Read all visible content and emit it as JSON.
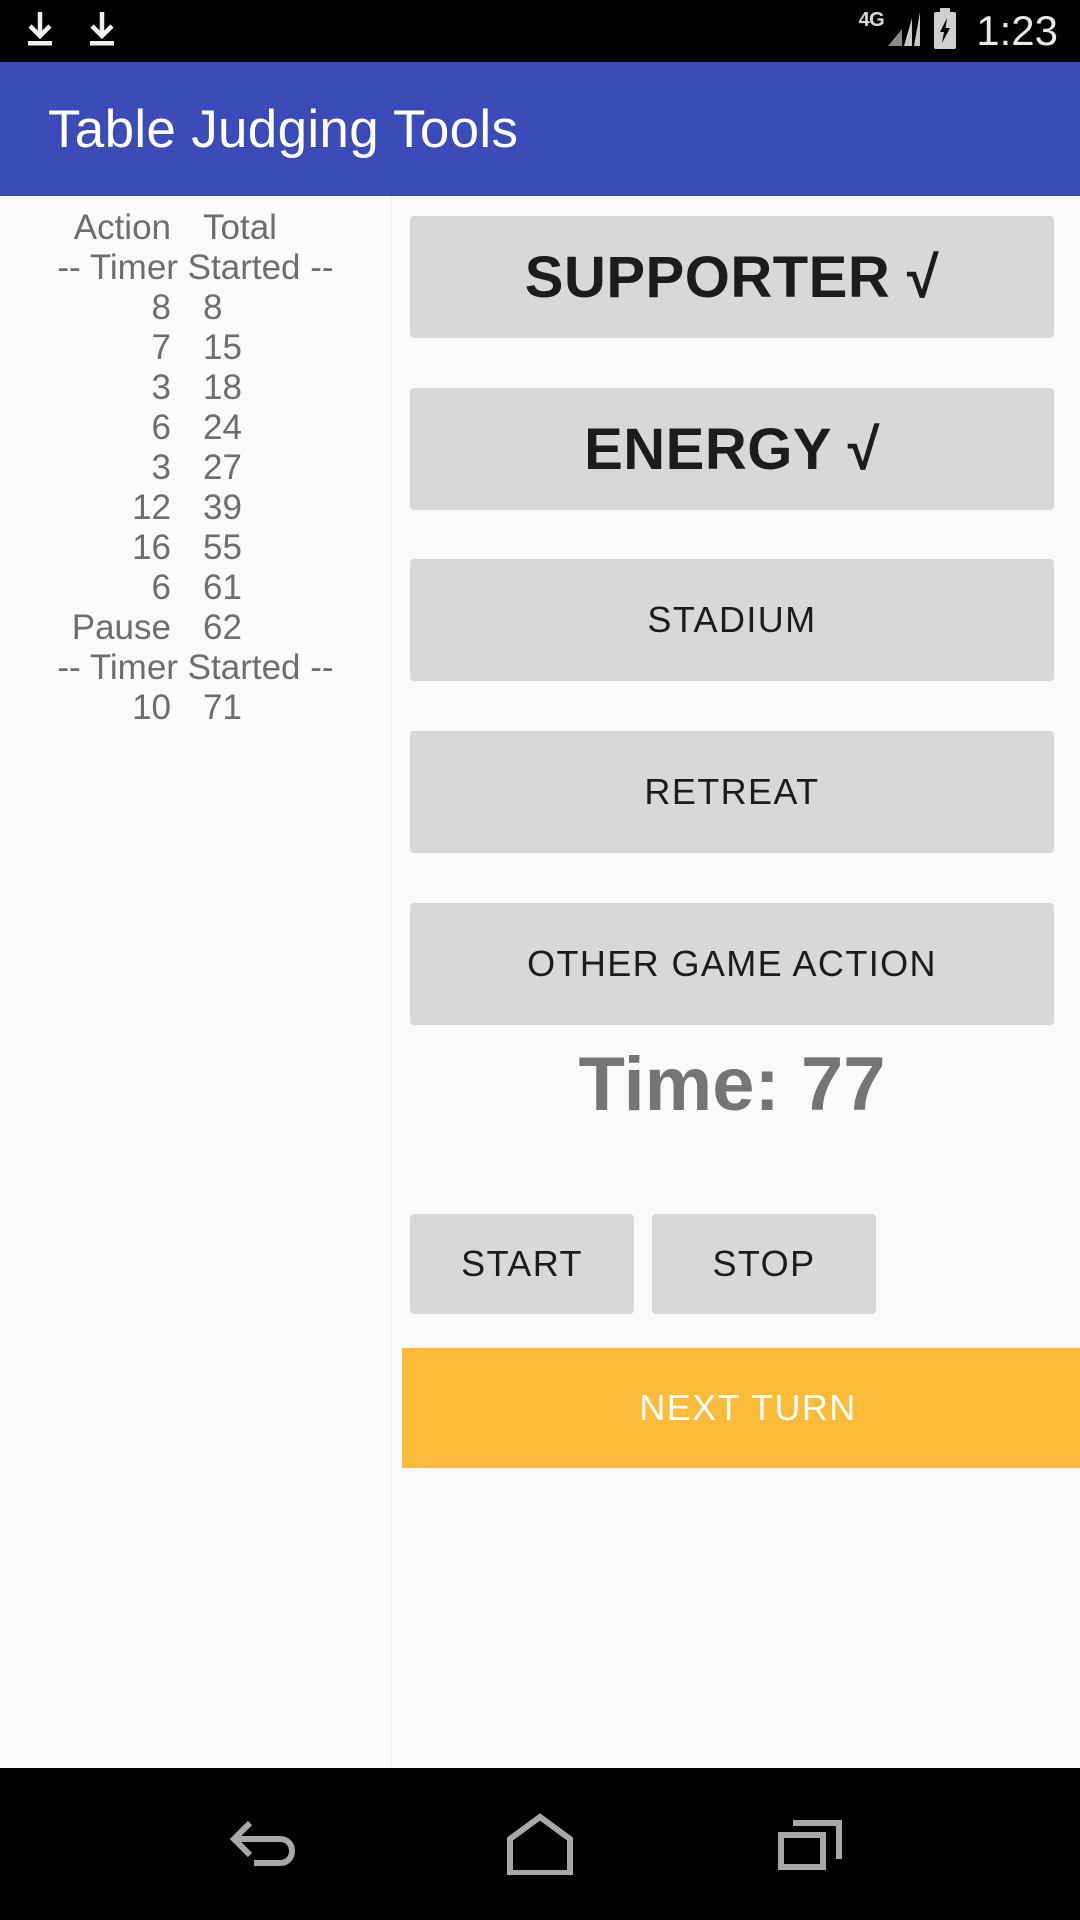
{
  "statusbar": {
    "download_icon_1": "download-icon",
    "download_icon_2": "download-icon",
    "network_label": "4G",
    "signal_icon": "signal-bars-icon",
    "battery_icon": "battery-charging-icon",
    "clock": "1:23"
  },
  "appbar": {
    "title": "Table Judging Tools"
  },
  "log": {
    "header": {
      "action": "Action",
      "total": "Total"
    },
    "rows": [
      {
        "type": "full",
        "text": "-- Timer Started --"
      },
      {
        "type": "pair",
        "action": "8",
        "total": "8"
      },
      {
        "type": "pair",
        "action": "7",
        "total": "15"
      },
      {
        "type": "pair",
        "action": "3",
        "total": "18"
      },
      {
        "type": "pair",
        "action": "6",
        "total": "24"
      },
      {
        "type": "pair",
        "action": "3",
        "total": "27"
      },
      {
        "type": "pair",
        "action": "12",
        "total": "39"
      },
      {
        "type": "pair",
        "action": "16",
        "total": "55"
      },
      {
        "type": "pair",
        "action": "6",
        "total": "61"
      },
      {
        "type": "pair",
        "action": "Pause",
        "total": "62"
      },
      {
        "type": "full",
        "text": "-- Timer Started --"
      },
      {
        "type": "pair",
        "action": "10",
        "total": "71"
      }
    ]
  },
  "actions": {
    "supporter": "SUPPORTER √",
    "energy": "ENERGY √",
    "stadium": "STADIUM",
    "retreat": "RETREAT",
    "other_game_action": "OTHER GAME ACTION"
  },
  "timer": {
    "display": "Time: 77",
    "value": 77,
    "start": "START",
    "stop": "STOP"
  },
  "next_turn": {
    "label": "NEXT TURN"
  },
  "navbar": {
    "back": "back-icon",
    "home": "home-icon",
    "recents": "recents-icon"
  },
  "colors": {
    "appbar": "#3b4cb8",
    "button": "#d7d8d8",
    "accent": "#fcbb38",
    "background": "#fafafa",
    "log_text": "#6e6e6e",
    "time_text": "#757575"
  }
}
